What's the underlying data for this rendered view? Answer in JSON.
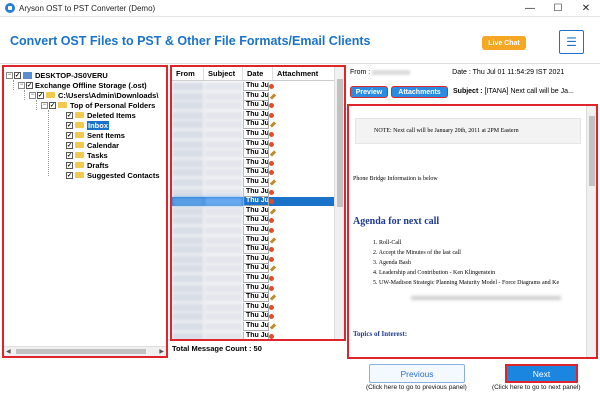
{
  "window": {
    "title": "Aryson OST to PST Converter (Demo)",
    "minimize": "—",
    "maximize": "☐",
    "close": "✕"
  },
  "header": {
    "title": "Convert OST Files to PST & Other File Formats/Email Clients",
    "live_chat": "Live Chat",
    "menu_icon": "☰"
  },
  "tree": {
    "items": [
      {
        "label": "DESKTOP-JS0VERU",
        "toggle": "−",
        "check": "✓"
      },
      {
        "label": "Exchange Offline Storage (.ost)",
        "toggle": "−",
        "check": "✓"
      },
      {
        "label": "C:\\Users\\Admin\\Downloads\\",
        "toggle": "−",
        "check": "✓"
      },
      {
        "label": "Top of Personal Folders",
        "toggle": "−",
        "check": "✓"
      },
      {
        "label": "Deleted Items",
        "check": "✓"
      },
      {
        "label": "Inbox",
        "check": "✓"
      },
      {
        "label": "Sent Items",
        "check": "✓"
      },
      {
        "label": "Calendar",
        "check": "✓"
      },
      {
        "label": "Tasks",
        "check": "✓"
      },
      {
        "label": "Drafts",
        "check": "✓"
      },
      {
        "label": "Suggested Contacts",
        "check": "✓"
      }
    ],
    "selected": "Inbox"
  },
  "messages": {
    "columns": [
      "From",
      "Subject",
      "Date",
      "Attachment"
    ],
    "row_date": "Thu Ju",
    "total_label": "Total Message Count : 50"
  },
  "preview": {
    "from_label": "From :",
    "date_label": "Date :",
    "date_value": "Thu Jul 01 11:54:29 IST 2021",
    "tab_preview": "Preview",
    "tab_attachments": "Attachments",
    "subject_label": "Subject :",
    "subject_value": "[ITANA] Next call will be Ja...",
    "note": "NOTE: Next call will be January 20th, 2011 at 2PM Eastern",
    "bridge": "Phone Bridge Information is below",
    "agenda_title": "Agenda for next call",
    "agenda_items": [
      "1.  Roll-Call",
      "2.  Accept the Minutes of the last call",
      "3.  Agenda Bash",
      "4.  Leadership and Contribution - Ken Klingenstein",
      "5.  UW-Madison Strategic Planning Maturity Model - Force Diagrams and Ke"
    ],
    "topics": "Topics of Interest:"
  },
  "footer": {
    "previous": "Previous",
    "previous_hint": "(Click here to go to previous panel)",
    "next": "Next",
    "next_hint": "(Click here to go to next panel)"
  }
}
